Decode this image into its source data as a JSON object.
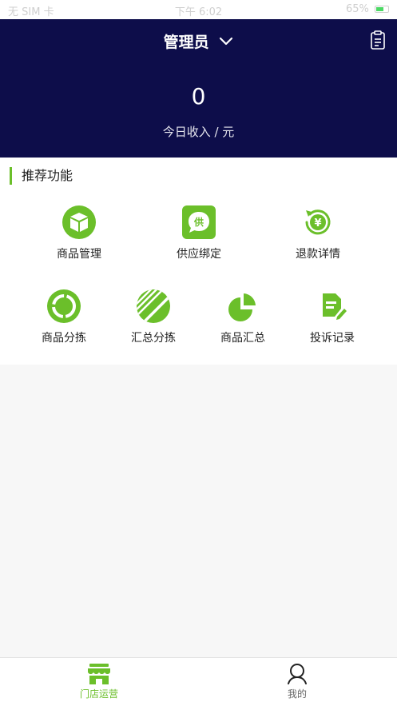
{
  "status_bar": {
    "carrier": "无 SIM 卡",
    "time": "下午 6:02",
    "battery": "65%"
  },
  "header": {
    "role": "管理员",
    "income_value": "0",
    "income_label": "今日收入 / 元"
  },
  "features": {
    "section_title": "推荐功能",
    "row1": [
      {
        "label": "商品管理",
        "icon": "box-icon"
      },
      {
        "label": "供应绑定",
        "icon": "supply-chat-icon"
      },
      {
        "label": "退款详情",
        "icon": "refund-yuan-icon"
      }
    ],
    "row2": [
      {
        "label": "商品分拣",
        "icon": "ring-icon"
      },
      {
        "label": "汇总分拣",
        "icon": "striped-circle-icon"
      },
      {
        "label": "商品汇总",
        "icon": "pie-chart-icon"
      },
      {
        "label": "投诉记录",
        "icon": "document-edit-icon"
      }
    ],
    "supply_glyph": "供",
    "refund_glyph": "¥"
  },
  "tabbar": {
    "tabs": [
      {
        "label": "门店运营",
        "icon": "store-icon",
        "active": true
      },
      {
        "label": "我的",
        "icon": "user-icon",
        "active": false
      }
    ]
  },
  "colors": {
    "header_bg": "#0d0d4a",
    "accent": "#6bbf2a",
    "active_tab": "#6bbf2a"
  }
}
